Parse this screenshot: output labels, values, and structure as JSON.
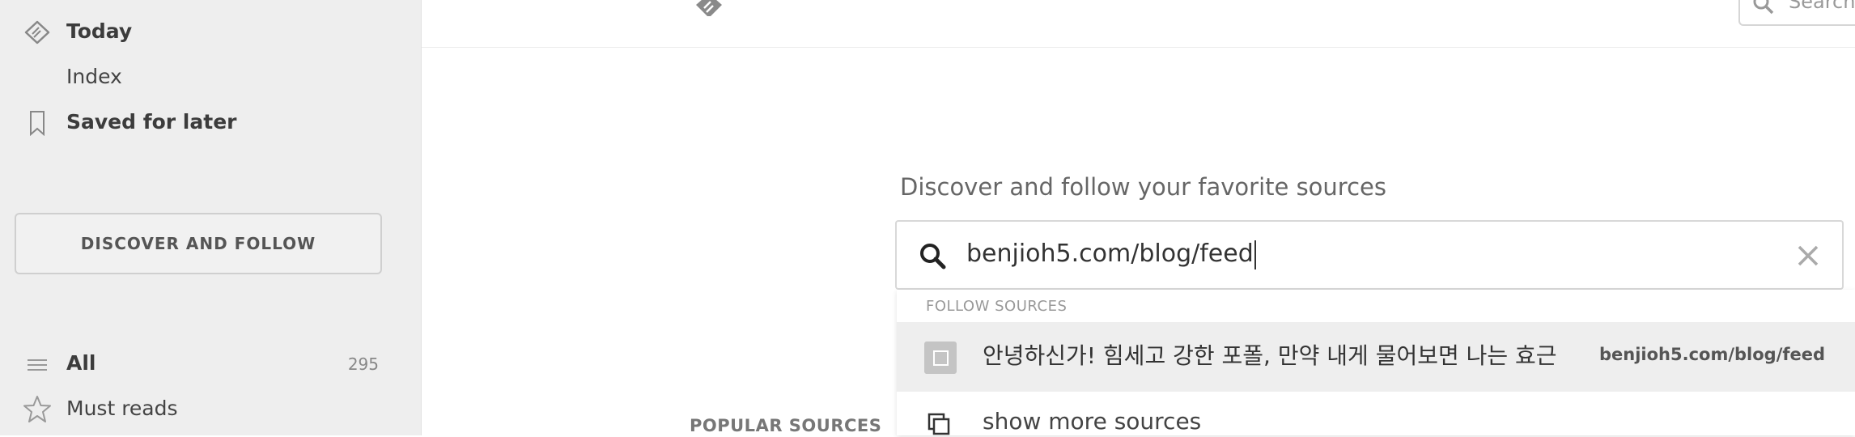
{
  "sidebar": {
    "today": {
      "label": "Today",
      "icon": "feedly-today-icon"
    },
    "index": {
      "label": "Index"
    },
    "saved": {
      "label": "Saved for later",
      "icon": "bookmark-icon"
    },
    "discover_button": "DISCOVER AND FOLLOW",
    "all": {
      "label": "All",
      "count": "295",
      "icon": "list-icon"
    },
    "must_reads": {
      "label": "Must reads",
      "icon": "star-icon"
    }
  },
  "topbar": {
    "logo_icon": "feedly-logo-icon",
    "search_placeholder": "Search",
    "search_icon": "search-icon"
  },
  "main": {
    "headline": "Discover and follow your favorite sources",
    "search_value": "benjioh5.com/blog/feed",
    "clear_icon": "close-icon",
    "dropdown": {
      "header": "FOLLOW SOURCES",
      "result": {
        "title": "안녕하신가! 힘세고 강한 포폴, 만약 내게 물어보면 나는 효근",
        "url": "benjioh5.com/blog/feed"
      },
      "show_more": "show more sources"
    },
    "popular_heading": "POPULAR SOURCES"
  },
  "colors": {
    "sidebar_bg": "#eeeeee",
    "highlight_row": "#eeeeee",
    "text": "#333333"
  }
}
